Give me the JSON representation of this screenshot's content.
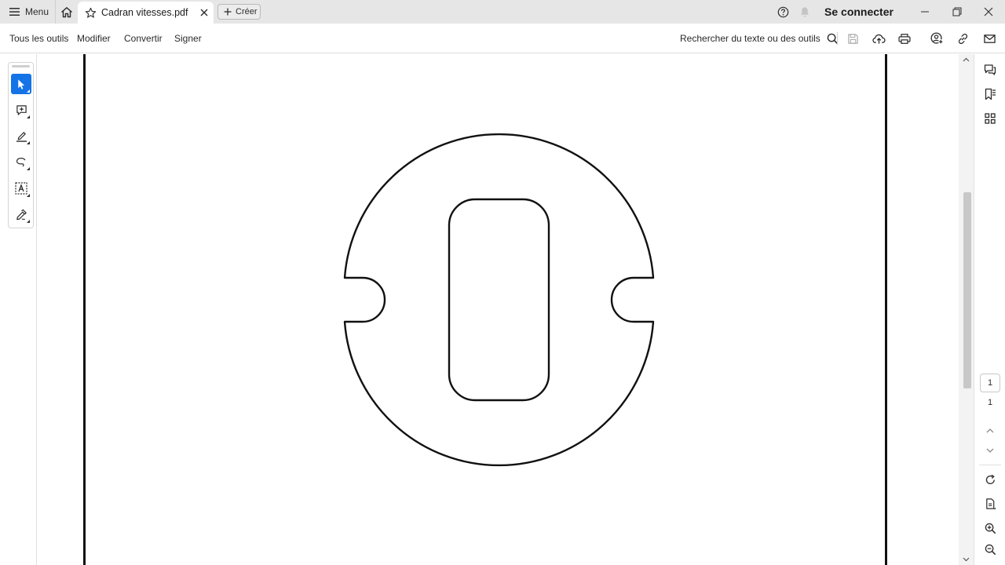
{
  "titlebar": {
    "menu_label": "Menu",
    "tab_title": "Cadran vitesses.pdf",
    "create_label": "Créer",
    "signin_label": "Se connecter"
  },
  "toolbar": {
    "menu_items": [
      "Tous les outils",
      "Modifier",
      "Convertir",
      "Signer"
    ],
    "search_label": "Rechercher du texte ou des outils"
  },
  "left_tools": {
    "items": [
      {
        "icon": "select-pointer-icon",
        "active": true
      },
      {
        "icon": "add-comment-icon",
        "active": false
      },
      {
        "icon": "highlight-pen-icon",
        "active": false
      },
      {
        "icon": "draw-freeform-icon",
        "active": false
      },
      {
        "icon": "text-select-icon",
        "active": false
      },
      {
        "icon": "fill-sign-icon",
        "active": false
      }
    ]
  },
  "right_panel": {
    "icons": [
      "comments-icon",
      "bookmarks-icon",
      "thumbnails-icon"
    ],
    "page_current": "1",
    "page_total": "1",
    "bottom_icons": [
      "page-up-icon",
      "page-down-icon",
      "rotate-icon",
      "document-info-icon",
      "zoom-in-icon",
      "zoom-out-icon"
    ]
  },
  "colors": {
    "accent": "#1473e6",
    "titlebar_bg": "#e6e6e6",
    "drawing_stroke": "#111111"
  }
}
